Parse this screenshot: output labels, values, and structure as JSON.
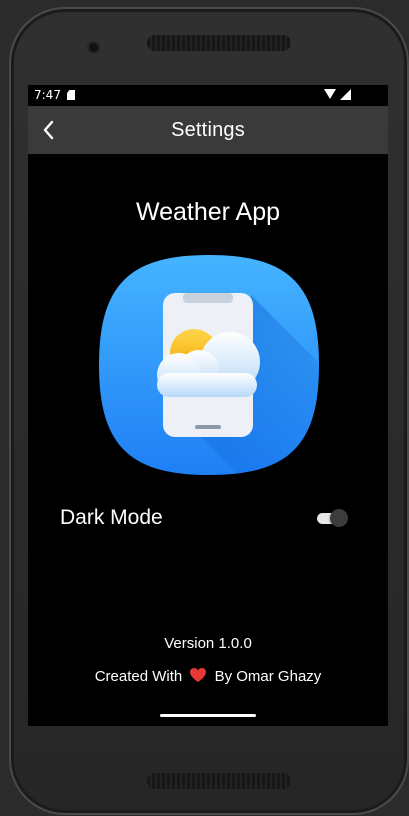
{
  "status_bar": {
    "time": "7:47",
    "icons": [
      "sim-card-icon",
      "wifi-icon",
      "cell-signal-icon"
    ]
  },
  "app_bar": {
    "title": "Settings",
    "back_icon": "chevron-left-icon"
  },
  "main": {
    "app_name": "Weather App",
    "logo_icon": "weather-phone-icon",
    "dark_mode": {
      "label": "Dark Mode",
      "enabled": true
    },
    "version": "Version 1.0.0",
    "credits": {
      "prefix": "Created With",
      "suffix": "By Omar Ghazy",
      "heart_icon": "heart-icon"
    }
  },
  "colors": {
    "screen_background": "#000000",
    "app_bar_background": "#3a3a3a",
    "text": "#ffffff",
    "logo_blue": "#2f8fff",
    "heart": "#e53935"
  }
}
